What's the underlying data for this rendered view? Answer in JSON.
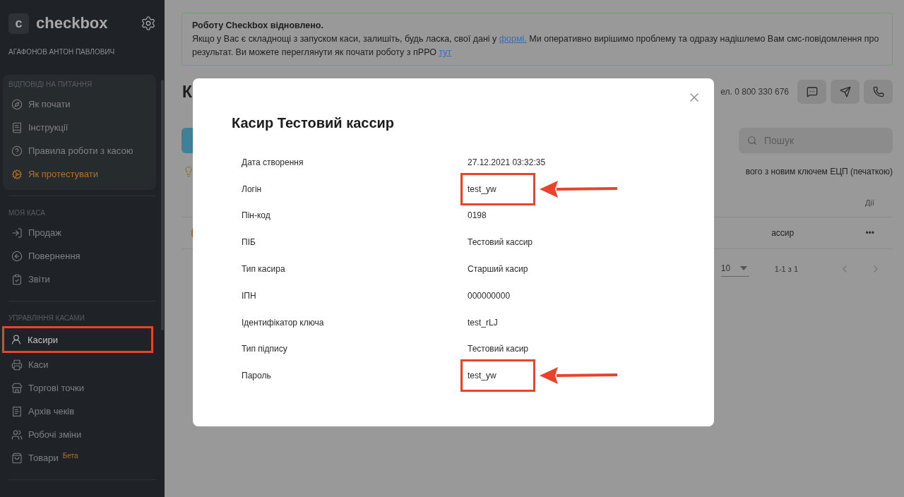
{
  "sidebar": {
    "logo_mark": "c",
    "logo": "checkbox",
    "user": "АГАФОНОВ АНТОН ПАВЛОВИЧ",
    "help": {
      "title": "ВІДПОВІДІ НА ПИТАННЯ",
      "items": [
        {
          "label": "Як почати",
          "kind": "nav",
          "selected": false,
          "highlighted": false
        },
        {
          "label": "Інструкції",
          "kind": "nav",
          "selected": false,
          "highlighted": false
        },
        {
          "label": "Правила роботи з касою",
          "kind": "nav",
          "selected": false,
          "highlighted": false
        },
        {
          "label": "Як протестувати",
          "kind": "accent",
          "selected": false,
          "highlighted": false
        }
      ]
    },
    "sections": [
      {
        "title": "МОЯ КАСА",
        "items": [
          {
            "label": "Продаж",
            "kind": "nav",
            "selected": false,
            "highlighted": false
          },
          {
            "label": "Повернення",
            "kind": "nav",
            "selected": false,
            "highlighted": false
          },
          {
            "label": "Звіти",
            "kind": "nav",
            "selected": false,
            "highlighted": false
          }
        ]
      },
      {
        "title": "УПРАВЛІННЯ КАСАМИ",
        "items": [
          {
            "label": "Касири",
            "kind": "nav",
            "selected": true,
            "highlighted": true
          },
          {
            "label": "Каси",
            "kind": "nav",
            "selected": false,
            "highlighted": false
          },
          {
            "label": "Торгові точки",
            "kind": "nav",
            "selected": false,
            "highlighted": false
          },
          {
            "label": "Архів чеків",
            "kind": "nav",
            "selected": false,
            "highlighted": false
          },
          {
            "label": "Робочі зміни",
            "kind": "nav",
            "selected": false,
            "highlighted": false
          },
          {
            "label": "Товари",
            "kind": "nav",
            "selected": false,
            "highlighted": false,
            "badge": "Бета"
          }
        ]
      }
    ]
  },
  "banner": {
    "title": "Роботу Checkbox відновлено.",
    "parts": [
      {
        "kind": "text",
        "text": "Якщо у Вас є складнощі з запуском каси, залишіть, будь ласка, свої дані у "
      },
      {
        "kind": "link",
        "text": "формі."
      },
      {
        "kind": "text",
        "text": " Ми оперативно вирішимо проблему та одразу надішлемо Вам смс-повідомлення про результат. Ви можете переглянути як почати роботу з пРРО "
      },
      {
        "kind": "link",
        "text": "тут"
      }
    ]
  },
  "page": {
    "heading": "К",
    "phone": "ел. 0 800 330 676",
    "search": {
      "placeholder": "Пошук"
    },
    "hint": "вого з новим ключем ЕЦП (печаткою)",
    "table": {
      "column_actions": "Дії",
      "row_cell": "ассир",
      "row_menu": "•••"
    },
    "pagination": {
      "page_size": "10",
      "range": "1-1 з 1"
    }
  },
  "modal": {
    "title": "Касир Тестовий кассир",
    "fields": [
      {
        "label": "Дата створення",
        "value": "27.12.2021 03:32:35",
        "highlighted": false
      },
      {
        "label": "Логін",
        "value": "test_yw",
        "highlighted": true
      },
      {
        "label": "Пін-код",
        "value": "0198",
        "highlighted": false
      },
      {
        "label": "ПІБ",
        "value": "Тестовий кассир",
        "highlighted": false
      },
      {
        "label": "Тип касира",
        "value": "Старший касир",
        "highlighted": false
      },
      {
        "label": "ІПН",
        "value": "000000000",
        "highlighted": false
      },
      {
        "label": "Ідентифікатор ключа",
        "value": "test_rLJ",
        "highlighted": false
      },
      {
        "label": "Тип підпису",
        "value": "Тестовий касир",
        "highlighted": false
      },
      {
        "label": "Пароль",
        "value": "test_yw",
        "highlighted": true
      }
    ]
  }
}
